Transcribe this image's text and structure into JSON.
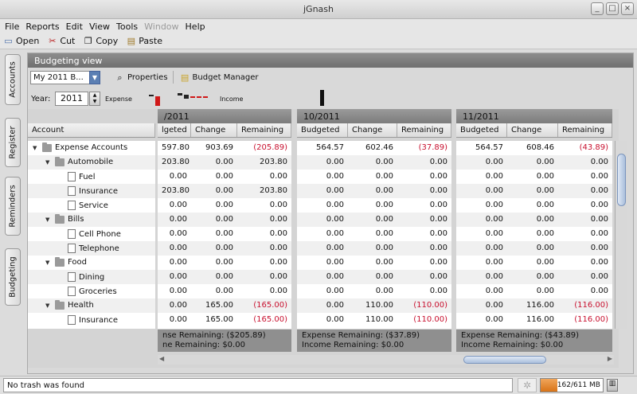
{
  "window": {
    "title": "jGnash"
  },
  "menu": [
    "File",
    "Reports",
    "Edit",
    "View",
    "Tools",
    "Window",
    "Help"
  ],
  "menu_disabled": "Window",
  "toolbar": {
    "open": "Open",
    "cut": "Cut",
    "copy": "Copy",
    "paste": "Paste"
  },
  "side_tabs": [
    "Accounts",
    "Register",
    "Reminders",
    "Budgeting"
  ],
  "panel": {
    "title": "Budgeting view",
    "budget_select": "My 2011 B...",
    "properties": "Properties",
    "budget_manager": "Budget Manager",
    "year_label": "Year:",
    "year_value": "2011",
    "expense_label": "Expense",
    "income_label": "Income"
  },
  "account_header": "Account",
  "accounts": [
    {
      "label": "Expense Accounts",
      "level": 0,
      "type": "folder"
    },
    {
      "label": "Automobile",
      "level": 1,
      "type": "folder"
    },
    {
      "label": "Fuel",
      "level": 2,
      "type": "doc"
    },
    {
      "label": "Insurance",
      "level": 2,
      "type": "doc"
    },
    {
      "label": "Service",
      "level": 2,
      "type": "doc"
    },
    {
      "label": "Bills",
      "level": 1,
      "type": "folder"
    },
    {
      "label": "Cell Phone",
      "level": 2,
      "type": "doc"
    },
    {
      "label": "Telephone",
      "level": 2,
      "type": "doc"
    },
    {
      "label": "Food",
      "level": 1,
      "type": "folder"
    },
    {
      "label": "Dining",
      "level": 2,
      "type": "doc"
    },
    {
      "label": "Groceries",
      "level": 2,
      "type": "doc"
    },
    {
      "label": "Health",
      "level": 1,
      "type": "folder"
    },
    {
      "label": "Insurance",
      "level": 2,
      "type": "doc"
    }
  ],
  "columns": [
    "Budgeted",
    "Change",
    "Remaining"
  ],
  "col_first_partial": "lgeted",
  "periods": [
    {
      "label": "/2011",
      "rows": [
        [
          "597.80",
          "903.69",
          "(205.89)"
        ],
        [
          "203.80",
          "0.00",
          "203.80"
        ],
        [
          "0.00",
          "0.00",
          "0.00"
        ],
        [
          "203.80",
          "0.00",
          "203.80"
        ],
        [
          "0.00",
          "0.00",
          "0.00"
        ],
        [
          "0.00",
          "0.00",
          "0.00"
        ],
        [
          "0.00",
          "0.00",
          "0.00"
        ],
        [
          "0.00",
          "0.00",
          "0.00"
        ],
        [
          "0.00",
          "0.00",
          "0.00"
        ],
        [
          "0.00",
          "0.00",
          "0.00"
        ],
        [
          "0.00",
          "0.00",
          "0.00"
        ],
        [
          "0.00",
          "165.00",
          "(165.00)"
        ],
        [
          "0.00",
          "165.00",
          "(165.00)"
        ]
      ],
      "footer": [
        "nse Remaining: ($205.89)",
        "ne Remaining: $0.00"
      ]
    },
    {
      "label": "10/2011",
      "rows": [
        [
          "564.57",
          "602.46",
          "(37.89)"
        ],
        [
          "0.00",
          "0.00",
          "0.00"
        ],
        [
          "0.00",
          "0.00",
          "0.00"
        ],
        [
          "0.00",
          "0.00",
          "0.00"
        ],
        [
          "0.00",
          "0.00",
          "0.00"
        ],
        [
          "0.00",
          "0.00",
          "0.00"
        ],
        [
          "0.00",
          "0.00",
          "0.00"
        ],
        [
          "0.00",
          "0.00",
          "0.00"
        ],
        [
          "0.00",
          "0.00",
          "0.00"
        ],
        [
          "0.00",
          "0.00",
          "0.00"
        ],
        [
          "0.00",
          "0.00",
          "0.00"
        ],
        [
          "0.00",
          "110.00",
          "(110.00)"
        ],
        [
          "0.00",
          "110.00",
          "(110.00)"
        ]
      ],
      "footer": [
        "Expense Remaining: ($37.89)",
        "Income Remaining: $0.00"
      ]
    },
    {
      "label": "11/2011",
      "rows": [
        [
          "564.57",
          "608.46",
          "(43.89)"
        ],
        [
          "0.00",
          "0.00",
          "0.00"
        ],
        [
          "0.00",
          "0.00",
          "0.00"
        ],
        [
          "0.00",
          "0.00",
          "0.00"
        ],
        [
          "0.00",
          "0.00",
          "0.00"
        ],
        [
          "0.00",
          "0.00",
          "0.00"
        ],
        [
          "0.00",
          "0.00",
          "0.00"
        ],
        [
          "0.00",
          "0.00",
          "0.00"
        ],
        [
          "0.00",
          "0.00",
          "0.00"
        ],
        [
          "0.00",
          "0.00",
          "0.00"
        ],
        [
          "0.00",
          "0.00",
          "0.00"
        ],
        [
          "0.00",
          "116.00",
          "(116.00)"
        ],
        [
          "0.00",
          "116.00",
          "(116.00)"
        ]
      ],
      "footer": [
        "Expense Remaining: ($43.89)",
        "Income Remaining: $0.00"
      ]
    }
  ],
  "status": {
    "message": "No trash was found",
    "memory": "162/611 MB",
    "memory_fraction": 0.265
  },
  "colors": {
    "negative": "#c8102e",
    "header": "#8d8d8d",
    "memory": "#d87318"
  }
}
